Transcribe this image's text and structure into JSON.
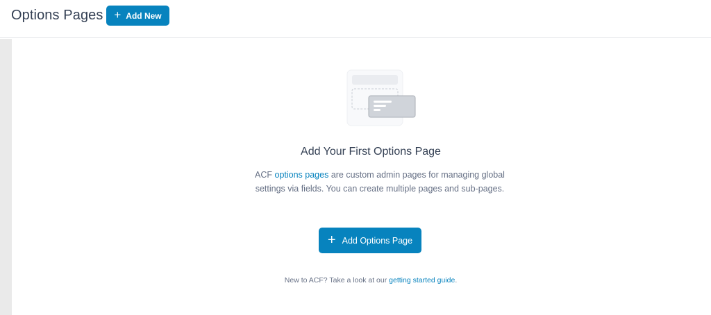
{
  "header": {
    "title": "Options Pages",
    "add_new_label": "Add New"
  },
  "empty_state": {
    "title": "Add Your First Options Page",
    "desc_prefix": "ACF ",
    "desc_link": "options pages",
    "desc_suffix": " are custom admin pages for managing global settings via fields. You can create multiple pages and sub-pages.",
    "button_label": "Add Options Page",
    "guide_prefix": "New to ACF? Take a look at our ",
    "guide_link": "getting started guide",
    "guide_suffix": "."
  },
  "colors": {
    "accent": "#0783be",
    "title_text": "#344054",
    "body_text": "#667085"
  }
}
